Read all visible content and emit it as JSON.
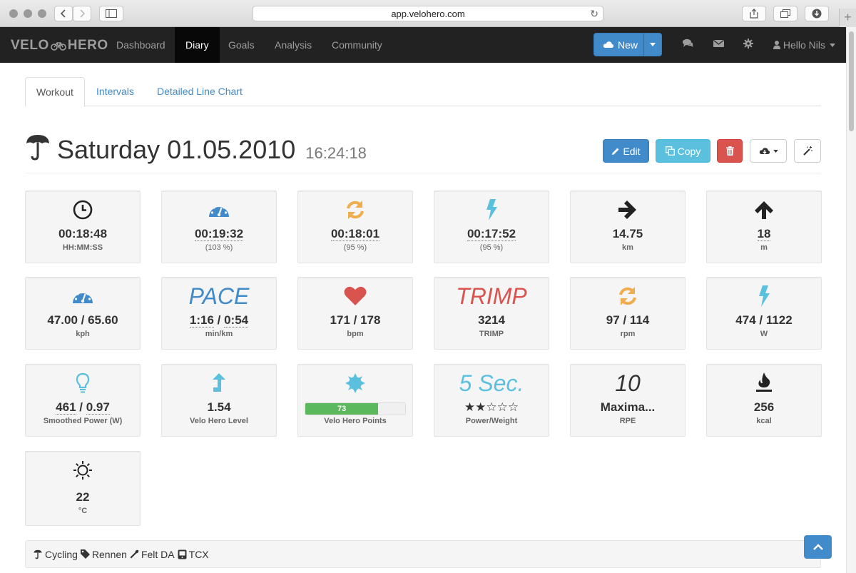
{
  "browser": {
    "url": "app.velohero.com"
  },
  "navbar": {
    "brand_left": "VELO",
    "brand_right": "HERO",
    "items": [
      {
        "label": "Dashboard"
      },
      {
        "label": "Diary"
      },
      {
        "label": "Goals"
      },
      {
        "label": "Analysis"
      },
      {
        "label": "Community"
      }
    ],
    "new_label": "New",
    "user_label": "Hello Nils"
  },
  "tabs": [
    {
      "label": "Workout"
    },
    {
      "label": "Intervals"
    },
    {
      "label": "Detailed Line Chart"
    }
  ],
  "header": {
    "title": "Saturday 01.05.2010",
    "time": "16:24:18",
    "edit_label": "Edit",
    "copy_label": "Copy"
  },
  "tiles": {
    "duration": {
      "value": "00:18:48",
      "label": "HH:MM:SS"
    },
    "moving": {
      "value": "00:19:32",
      "label": "(103 %)"
    },
    "cadence_time": {
      "value": "00:18:01",
      "label": "(95 %)"
    },
    "power_time": {
      "value": "00:17:52",
      "label": "(95 %)"
    },
    "distance": {
      "value": "14.75",
      "label": "km"
    },
    "ascent": {
      "value": "18",
      "label": "m"
    },
    "speed": {
      "value": "47.00 / 65.60",
      "label": "kph"
    },
    "pace": {
      "title": "PACE",
      "value_a": "1:16",
      "sep": " / ",
      "value_b": "0:54",
      "label": "min/km"
    },
    "heart": {
      "value": "171 / 178",
      "label": "bpm"
    },
    "trimp": {
      "title": "TRIMP",
      "value": "3214",
      "label": "TRIMP"
    },
    "rpm": {
      "value": "97 / 114",
      "label": "rpm"
    },
    "watts": {
      "value": "474 / 1122",
      "label": "W"
    },
    "smoothed": {
      "value_a": "461",
      "sep": " / ",
      "value_b": "0.97",
      "label": "Smoothed Power (W)"
    },
    "level": {
      "value": "1.54",
      "label": "Velo Hero Level"
    },
    "points": {
      "value": "73",
      "progress_percent": 73,
      "label": "Velo Hero Points"
    },
    "pw": {
      "title": "5 Sec.",
      "stars_filled": 2,
      "stars_total": 5,
      "label": "Power/Weight"
    },
    "rpe": {
      "title": "10",
      "value": "Maxima...",
      "label": "RPE"
    },
    "kcal": {
      "value": "256",
      "label": "kcal"
    },
    "temp": {
      "value": "22",
      "label": "°C"
    }
  },
  "footer": {
    "sport": "Cycling",
    "tag": "Rennen",
    "equipment": "Felt DA",
    "file": "TCX"
  },
  "colors": {
    "blue": "#428bca",
    "orange": "#f0ad4e",
    "cyan": "#5bc0de",
    "red": "#d9534f",
    "green": "#5cb85c",
    "dark": "#222222"
  }
}
